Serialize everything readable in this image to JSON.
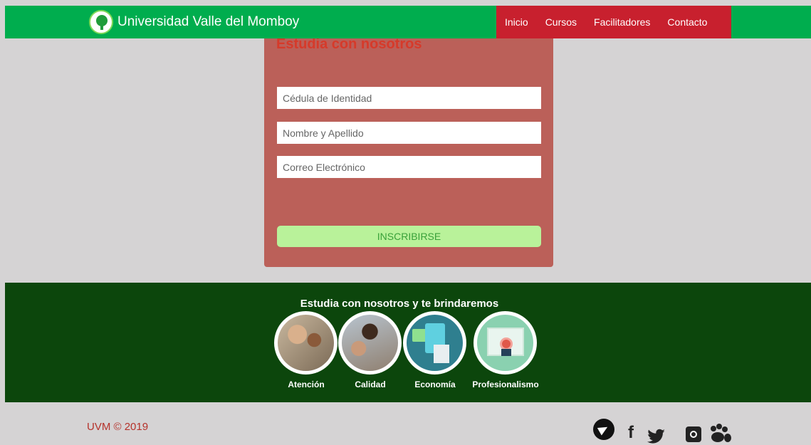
{
  "header": {
    "brand_name": "Universidad Valle del Momboy",
    "nav": [
      "Inicio",
      "Cursos",
      "Facilitadores",
      "Contacto"
    ],
    "nav_color": "#c8202e",
    "bar_color": "#00ad4e"
  },
  "form": {
    "title": "Estudia con nosotros",
    "fields": [
      {
        "placeholder": "Cédula de Identidad"
      },
      {
        "placeholder": "Nombre y Apellido"
      },
      {
        "placeholder": "Correo Electrónico"
      }
    ],
    "submit_label": "INSCRIBIRSE",
    "card_color": "#bb6059"
  },
  "features": {
    "title": "Estudia con nosotros y te brindaremos",
    "items": [
      {
        "label": "Atención",
        "icon": "students-photo"
      },
      {
        "label": "Calidad",
        "icon": "team-photo"
      },
      {
        "label": "Economía",
        "icon": "calculator-icon"
      },
      {
        "label": "Profesionalismo",
        "icon": "certificate-icon"
      }
    ],
    "band_color": "#0c460c"
  },
  "footer": {
    "copyright": "UVM © 2019",
    "social": [
      "telegram-icon",
      "facebook-icon",
      "twitter-icon",
      "instagram-icon",
      "paw-icon"
    ]
  }
}
